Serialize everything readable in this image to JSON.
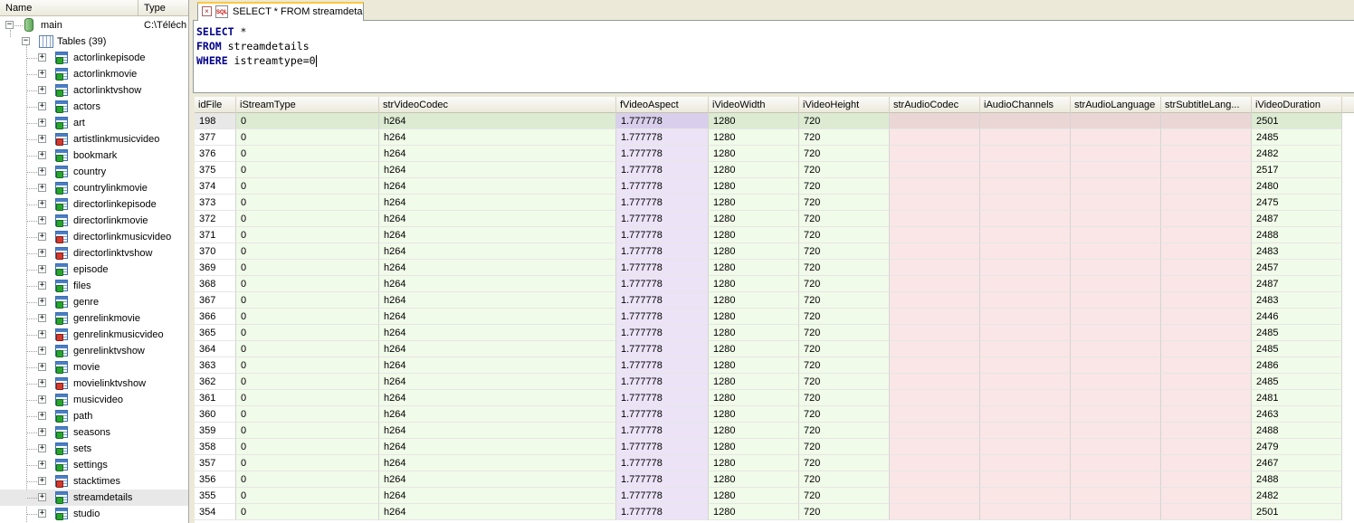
{
  "tree": {
    "header": {
      "name_col": "Name",
      "type_col": "Type"
    },
    "db": {
      "name": "main",
      "type": "C:\\Téléch"
    },
    "tables_label": "Tables (39)",
    "tables": [
      {
        "label": "actorlinkepisode",
        "icon": "table-icon"
      },
      {
        "label": "actorlinkmovie",
        "icon": "table-icon"
      },
      {
        "label": "actorlinktvshow",
        "icon": "table-icon"
      },
      {
        "label": "actors",
        "icon": "table-icon"
      },
      {
        "label": "art",
        "icon": "table-icon"
      },
      {
        "label": "artistlinkmusicvideo",
        "icon": "table-icon-red"
      },
      {
        "label": "bookmark",
        "icon": "table-icon"
      },
      {
        "label": "country",
        "icon": "table-icon"
      },
      {
        "label": "countrylinkmovie",
        "icon": "table-icon"
      },
      {
        "label": "directorlinkepisode",
        "icon": "table-icon"
      },
      {
        "label": "directorlinkmovie",
        "icon": "table-icon"
      },
      {
        "label": "directorlinkmusicvideo",
        "icon": "table-icon-red"
      },
      {
        "label": "directorlinktvshow",
        "icon": "table-icon-red"
      },
      {
        "label": "episode",
        "icon": "table-icon"
      },
      {
        "label": "files",
        "icon": "table-icon"
      },
      {
        "label": "genre",
        "icon": "table-icon"
      },
      {
        "label": "genrelinkmovie",
        "icon": "table-icon"
      },
      {
        "label": "genrelinkmusicvideo",
        "icon": "table-icon-red"
      },
      {
        "label": "genrelinktvshow",
        "icon": "table-icon"
      },
      {
        "label": "movie",
        "icon": "table-icon"
      },
      {
        "label": "movielinktvshow",
        "icon": "table-icon-red"
      },
      {
        "label": "musicvideo",
        "icon": "table-icon"
      },
      {
        "label": "path",
        "icon": "table-icon"
      },
      {
        "label": "seasons",
        "icon": "table-icon"
      },
      {
        "label": "sets",
        "icon": "table-icon"
      },
      {
        "label": "settings",
        "icon": "table-icon"
      },
      {
        "label": "stacktimes",
        "icon": "table-icon-red"
      },
      {
        "label": "streamdetails",
        "icon": "table-icon",
        "selected": true
      },
      {
        "label": "studio",
        "icon": "table-icon"
      }
    ]
  },
  "tab": {
    "label": "SELECT * FROM streamdeta"
  },
  "sql": {
    "lines": [
      {
        "kw": "SELECT",
        "rest": " *"
      },
      {
        "kw": "FROM",
        "rest": " streamdetails"
      },
      {
        "kw": "WHERE",
        "rest": " istreamtype=0"
      }
    ]
  },
  "grid": {
    "columns": [
      {
        "label": "idFile",
        "tint": "plain"
      },
      {
        "label": "iStreamType",
        "tint": "green"
      },
      {
        "label": "strVideoCodec",
        "tint": "green"
      },
      {
        "label": "fVideoAspect",
        "tint": "purple"
      },
      {
        "label": "iVideoWidth",
        "tint": "green"
      },
      {
        "label": "iVideoHeight",
        "tint": "green"
      },
      {
        "label": "strAudioCodec",
        "tint": "pink"
      },
      {
        "label": "iAudioChannels",
        "tint": "pink"
      },
      {
        "label": "strAudioLanguage",
        "tint": "pink"
      },
      {
        "label": "strSubtitleLang...",
        "tint": "pink"
      },
      {
        "label": "iVideoDuration",
        "tint": "green"
      }
    ],
    "rows": [
      [
        "198",
        "0",
        "h264",
        "1.777778",
        "1280",
        "720",
        "",
        "",
        "",
        "",
        "2501"
      ],
      [
        "377",
        "0",
        "h264",
        "1.777778",
        "1280",
        "720",
        "",
        "",
        "",
        "",
        "2485"
      ],
      [
        "376",
        "0",
        "h264",
        "1.777778",
        "1280",
        "720",
        "",
        "",
        "",
        "",
        "2482"
      ],
      [
        "375",
        "0",
        "h264",
        "1.777778",
        "1280",
        "720",
        "",
        "",
        "",
        "",
        "2517"
      ],
      [
        "374",
        "0",
        "h264",
        "1.777778",
        "1280",
        "720",
        "",
        "",
        "",
        "",
        "2480"
      ],
      [
        "373",
        "0",
        "h264",
        "1.777778",
        "1280",
        "720",
        "",
        "",
        "",
        "",
        "2475"
      ],
      [
        "372",
        "0",
        "h264",
        "1.777778",
        "1280",
        "720",
        "",
        "",
        "",
        "",
        "2487"
      ],
      [
        "371",
        "0",
        "h264",
        "1.777778",
        "1280",
        "720",
        "",
        "",
        "",
        "",
        "2488"
      ],
      [
        "370",
        "0",
        "h264",
        "1.777778",
        "1280",
        "720",
        "",
        "",
        "",
        "",
        "2483"
      ],
      [
        "369",
        "0",
        "h264",
        "1.777778",
        "1280",
        "720",
        "",
        "",
        "",
        "",
        "2457"
      ],
      [
        "368",
        "0",
        "h264",
        "1.777778",
        "1280",
        "720",
        "",
        "",
        "",
        "",
        "2487"
      ],
      [
        "367",
        "0",
        "h264",
        "1.777778",
        "1280",
        "720",
        "",
        "",
        "",
        "",
        "2483"
      ],
      [
        "366",
        "0",
        "h264",
        "1.777778",
        "1280",
        "720",
        "",
        "",
        "",
        "",
        "2446"
      ],
      [
        "365",
        "0",
        "h264",
        "1.777778",
        "1280",
        "720",
        "",
        "",
        "",
        "",
        "2485"
      ],
      [
        "364",
        "0",
        "h264",
        "1.777778",
        "1280",
        "720",
        "",
        "",
        "",
        "",
        "2485"
      ],
      [
        "363",
        "0",
        "h264",
        "1.777778",
        "1280",
        "720",
        "",
        "",
        "",
        "",
        "2486"
      ],
      [
        "362",
        "0",
        "h264",
        "1.777778",
        "1280",
        "720",
        "",
        "",
        "",
        "",
        "2485"
      ],
      [
        "361",
        "0",
        "h264",
        "1.777778",
        "1280",
        "720",
        "",
        "",
        "",
        "",
        "2481"
      ],
      [
        "360",
        "0",
        "h264",
        "1.777778",
        "1280",
        "720",
        "",
        "",
        "",
        "",
        "2463"
      ],
      [
        "359",
        "0",
        "h264",
        "1.777778",
        "1280",
        "720",
        "",
        "",
        "",
        "",
        "2488"
      ],
      [
        "358",
        "0",
        "h264",
        "1.777778",
        "1280",
        "720",
        "",
        "",
        "",
        "",
        "2479"
      ],
      [
        "357",
        "0",
        "h264",
        "1.777778",
        "1280",
        "720",
        "",
        "",
        "",
        "",
        "2467"
      ],
      [
        "356",
        "0",
        "h264",
        "1.777778",
        "1280",
        "720",
        "",
        "",
        "",
        "",
        "2488"
      ],
      [
        "355",
        "0",
        "h264",
        "1.777778",
        "1280",
        "720",
        "",
        "",
        "",
        "",
        "2482"
      ],
      [
        "354",
        "0",
        "h264",
        "1.777778",
        "1280",
        "720",
        "",
        "",
        "",
        "",
        "2501"
      ]
    ]
  }
}
